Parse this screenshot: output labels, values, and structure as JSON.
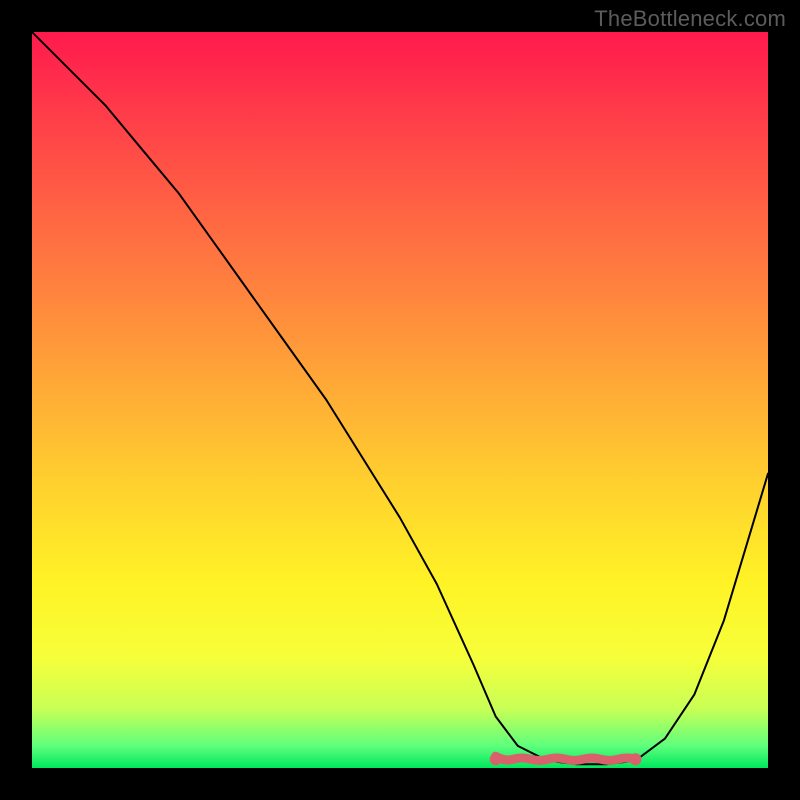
{
  "watermark": "TheBottleneck.com",
  "chart_data": {
    "type": "line",
    "title": "",
    "xlabel": "",
    "ylabel": "",
    "xlim": [
      0,
      100
    ],
    "ylim": [
      0,
      100
    ],
    "series": [
      {
        "name": "curve",
        "x": [
          0,
          5,
          10,
          15,
          20,
          25,
          30,
          35,
          40,
          45,
          50,
          55,
          60,
          63,
          66,
          70,
          74,
          78,
          82,
          86,
          90,
          94,
          100
        ],
        "y": [
          100,
          95,
          90,
          84,
          78,
          71,
          64,
          57,
          50,
          42,
          34,
          25,
          14,
          7,
          3,
          1,
          0.5,
          0.5,
          1,
          4,
          10,
          20,
          40
        ]
      }
    ],
    "highlight_band": {
      "x_start": 63,
      "x_end": 82,
      "y": 1.2
    },
    "colors": {
      "background_top": "#ff1a4d",
      "background_bottom": "#00e85e",
      "curve": "#000000",
      "highlight": "#d9616b"
    }
  }
}
